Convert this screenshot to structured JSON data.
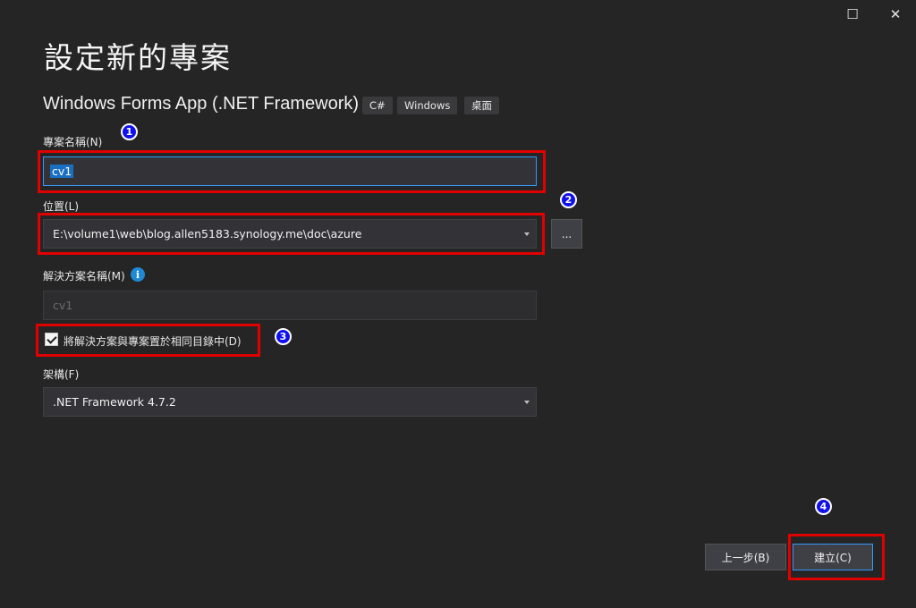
{
  "window": {
    "maximize_icon": "☐",
    "close_icon": "✕"
  },
  "page": {
    "title": "設定新的專案",
    "subtitle": "Windows Forms App (.NET Framework)",
    "tags": [
      "C#",
      "Windows",
      "桌面"
    ]
  },
  "form": {
    "project_name": {
      "label": "專案名稱(N)",
      "value": "cv1"
    },
    "location": {
      "label": "位置(L)",
      "value": "E:\\volume1\\web\\blog.allen5183.synology.me\\doc\\azure",
      "browse_label": "..."
    },
    "solution_name": {
      "label": "解決方案名稱(M)",
      "placeholder": "cv1",
      "info_icon": "i"
    },
    "same_dir_checkbox": {
      "label": "將解決方案與專案置於相同目錄中(D)",
      "checked": true
    },
    "framework": {
      "label": "架構(F)",
      "value": ".NET Framework 4.7.2"
    }
  },
  "buttons": {
    "back": "上一步(B)",
    "create": "建立(C)"
  },
  "annotations": [
    "1",
    "2",
    "3",
    "4"
  ],
  "colors": {
    "background": "#252526",
    "highlight": "#e00000",
    "badge": "#1010ee",
    "accent": "#3399ff"
  }
}
